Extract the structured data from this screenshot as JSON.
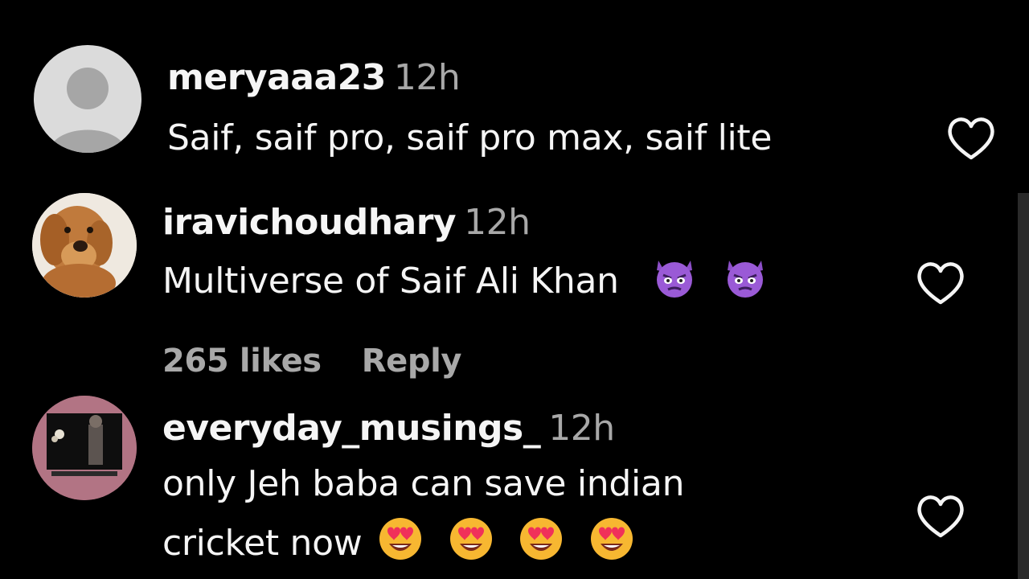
{
  "comments": [
    {
      "username": "meryaaa23",
      "time": "12h",
      "text": "Saif, saif pro, saif pro max, saif lite",
      "avatar": "default-avatar"
    },
    {
      "username": "iravichoudhary",
      "time": "12h",
      "text": "Multiverse of Saif Ali Khan",
      "emojis": [
        "angry-devil-emoji",
        "angry-devil-emoji"
      ],
      "likes": "265 likes",
      "reply": "Reply",
      "avatar": "dog-photo-avatar"
    },
    {
      "username": "everyday_musings_",
      "time": "12h",
      "text_line1": "only Jeh baba can save indian",
      "text_line2": "cricket now",
      "emojis": [
        "heart-eyes-emoji",
        "heart-eyes-emoji",
        "heart-eyes-emoji",
        "heart-eyes-emoji"
      ],
      "avatar": "photo-avatar"
    }
  ],
  "colors": {
    "background": "#000000",
    "primary_text": "#f5f5f5",
    "secondary_text": "#a8a8a8"
  }
}
